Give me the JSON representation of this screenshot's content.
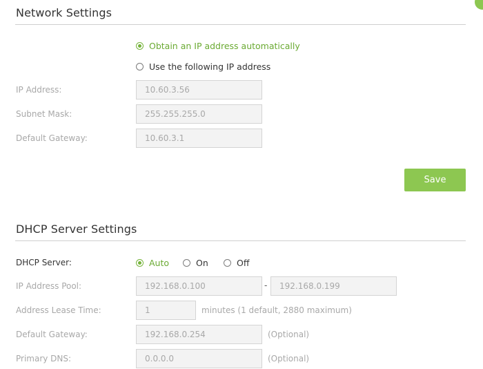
{
  "network": {
    "title": "Network Settings",
    "option_auto": "Obtain an IP address automatically",
    "option_manual": "Use the following IP address",
    "ip_label": "IP Address:",
    "ip_value": "10.60.3.56",
    "mask_label": "Subnet Mask:",
    "mask_value": "255.255.255.0",
    "gateway_label": "Default Gateway:",
    "gateway_value": "10.60.3.1",
    "save_label": "Save"
  },
  "dhcp": {
    "title": "DHCP Server Settings",
    "server_label": "DHCP Server:",
    "option_auto": "Auto",
    "option_on": "On",
    "option_off": "Off",
    "pool_label": "IP Address Pool:",
    "pool_start": "192.168.0.100",
    "pool_separator": "-",
    "pool_end": "192.168.0.199",
    "lease_label": "Address Lease Time:",
    "lease_value": "1",
    "lease_hint": "minutes (1 default, 2880 maximum)",
    "gateway_label": "Default Gateway:",
    "gateway_value": "192.168.0.254",
    "gateway_hint": "(Optional)",
    "dns_label": "Primary DNS:",
    "dns_value": "0.0.0.0",
    "dns_hint": "(Optional)"
  },
  "colors": {
    "accent": "#8dc751",
    "accent_text": "#6aaa32",
    "disabled_text": "#a8a8a8"
  }
}
